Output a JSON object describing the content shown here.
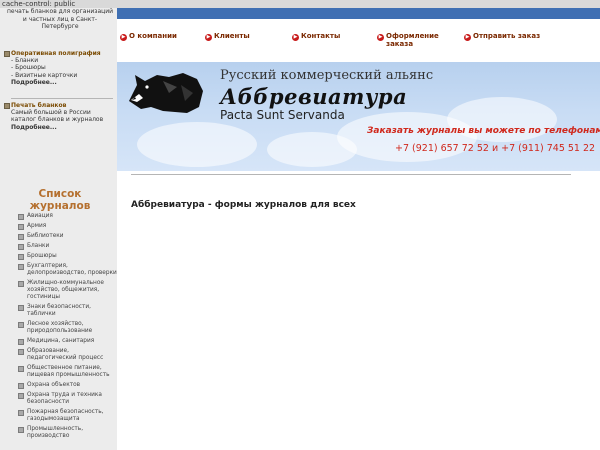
{
  "browser": {
    "status_text": "cache-control: public"
  },
  "left": {
    "tagline": "печать бланков для организаций и частных лиц в Санкт-Петербурге",
    "promo1": {
      "title": "Оперативная полиграфия",
      "items": [
        "- Бланки",
        "- Брошюры",
        "- Визитные карточки"
      ],
      "more": "Подробнее..."
    },
    "promo2": {
      "title": "Печать бланков",
      "desc": "Самый большой в России каталог бланков и журналов",
      "more": "Подробнее..."
    },
    "list_title": "Список журналов",
    "journals": [
      "Авиация",
      "Армия",
      "Библиотеки",
      "Бланки",
      "Брошюры",
      "Бухгалтерия, делопроизводство, проверки",
      "Жилищно-коммунальное хозяйство, общежития, гостиницы",
      "Знаки безопасности, таблички",
      "Лесное хозяйство, природопользование",
      "Медицина, санитария",
      "Образование, педагогический процесс",
      "Общественное питание, пищевая промышленность",
      "Охрана объектов",
      "Охрана труда и техника безопасности",
      "Пожарная безопасность, газодымозащита",
      "Промышленность, производство"
    ]
  },
  "nav": {
    "items": [
      {
        "label": "О компании"
      },
      {
        "label": "Клиенты"
      },
      {
        "label": "Контакты"
      },
      {
        "label": "Оформление заказа"
      },
      {
        "label": "Отправить заказ"
      }
    ]
  },
  "banner": {
    "line1": "Русский коммерческий альянс",
    "line2": "Аббревиатура",
    "line3": "Pacta Sunt Servanda",
    "phone_label": "Заказать журналы вы можете по телефонам",
    "phones": "+7 (921) 657 72 52 и +7 (911) 745 51 22"
  },
  "main": {
    "title": "Аббревиатура - формы журналов для всех"
  },
  "colors": {
    "accent_blue": "#3f6fb3",
    "nav_text": "#7a2800",
    "red": "#d0281c",
    "list_title": "#b5702f"
  }
}
